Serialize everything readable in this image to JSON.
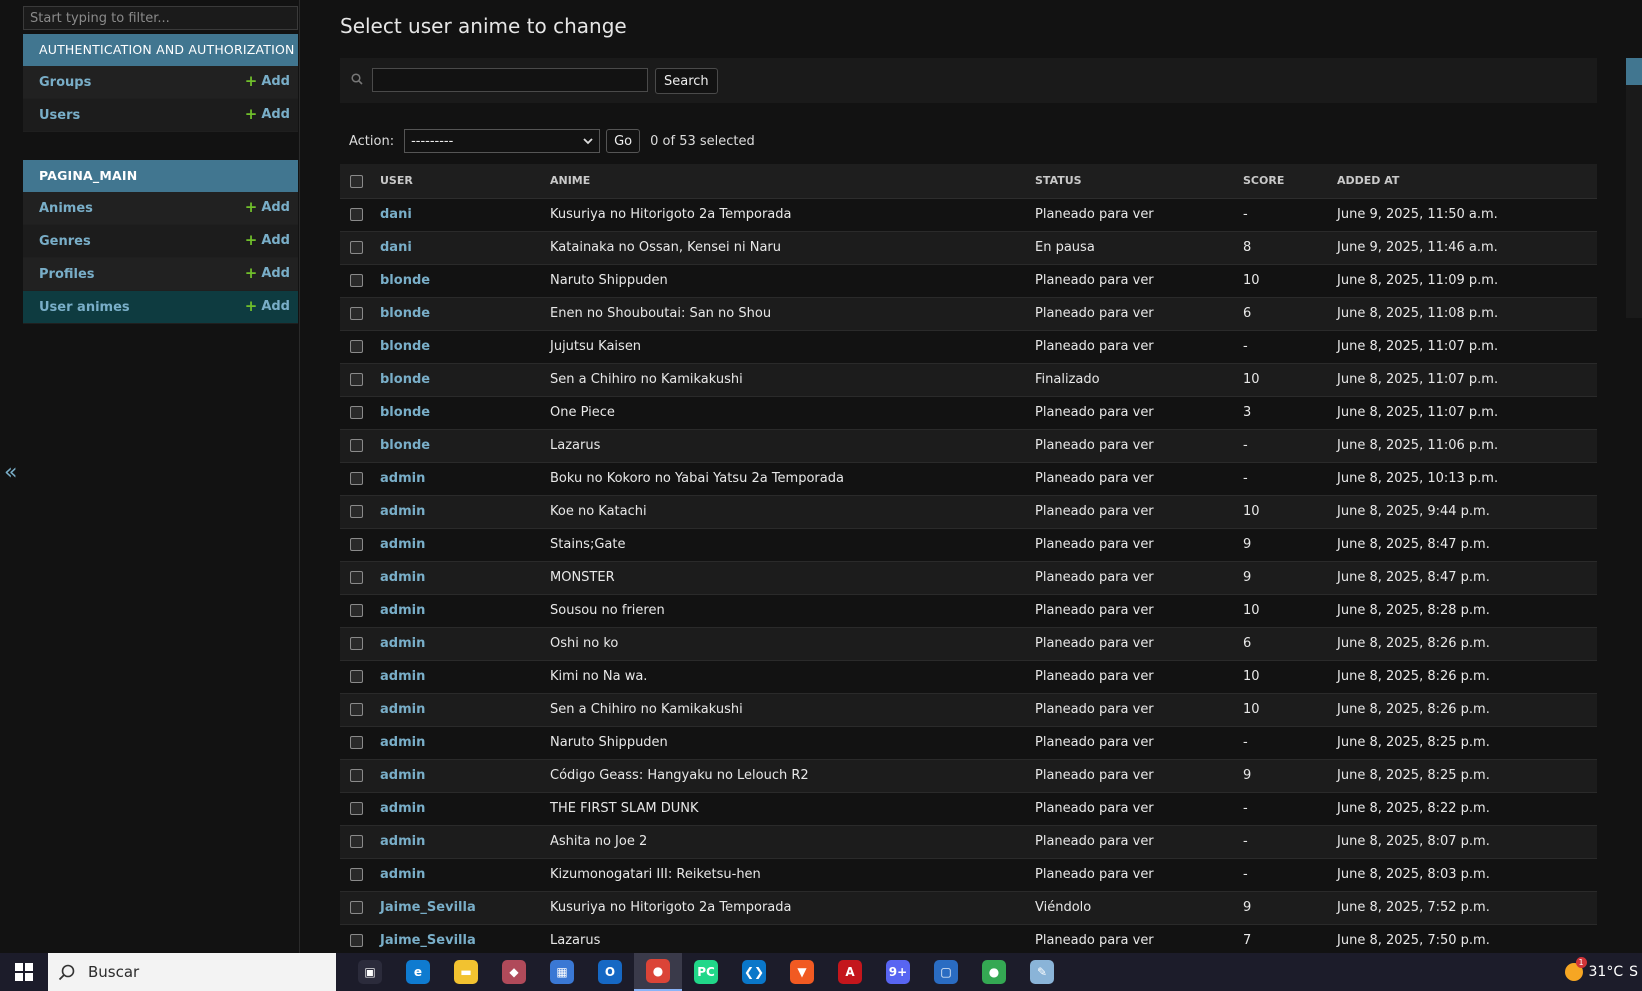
{
  "sidebar": {
    "filter_placeholder": "Start typing to filter...",
    "collapse_glyph": "«",
    "modules": [
      {
        "caption": "AUTHENTICATION AND AUTHORIZATION",
        "models": [
          {
            "label": "Groups",
            "add_label": "Add"
          },
          {
            "label": "Users",
            "add_label": "Add"
          }
        ]
      },
      {
        "caption": "PAGINA_MAIN",
        "models": [
          {
            "label": "Animes",
            "add_label": "Add"
          },
          {
            "label": "Genres",
            "add_label": "Add"
          },
          {
            "label": "Profiles",
            "add_label": "Add"
          },
          {
            "label": "User animes",
            "add_label": "Add",
            "current": true
          }
        ]
      }
    ]
  },
  "content": {
    "title": "Select user anime to change",
    "search_button": "Search",
    "action_label": "Action:",
    "action_selected": "---------",
    "go_button": "Go",
    "counter": "0 of 53 selected",
    "columns": [
      "User",
      "Anime",
      "Status",
      "Score",
      "Added at"
    ],
    "rows": [
      {
        "user": "dani",
        "anime": "Kusuriya no Hitorigoto 2a Temporada",
        "status": "Planeado para ver",
        "score": "-",
        "added": "June 9, 2025, 11:50 a.m."
      },
      {
        "user": "dani",
        "anime": "Katainaka no Ossan, Kensei ni Naru",
        "status": "En pausa",
        "score": "8",
        "added": "June 9, 2025, 11:46 a.m."
      },
      {
        "user": "blonde",
        "anime": "Naruto Shippuden",
        "status": "Planeado para ver",
        "score": "10",
        "added": "June 8, 2025, 11:09 p.m."
      },
      {
        "user": "blonde",
        "anime": "Enen no Shouboutai: San no Shou",
        "status": "Planeado para ver",
        "score": "6",
        "added": "June 8, 2025, 11:08 p.m."
      },
      {
        "user": "blonde",
        "anime": "Jujutsu Kaisen",
        "status": "Planeado para ver",
        "score": "-",
        "added": "June 8, 2025, 11:07 p.m."
      },
      {
        "user": "blonde",
        "anime": "Sen a Chihiro no Kamikakushi",
        "status": "Finalizado",
        "score": "10",
        "added": "June 8, 2025, 11:07 p.m."
      },
      {
        "user": "blonde",
        "anime": "One Piece",
        "status": "Planeado para ver",
        "score": "3",
        "added": "June 8, 2025, 11:07 p.m."
      },
      {
        "user": "blonde",
        "anime": "Lazarus",
        "status": "Planeado para ver",
        "score": "-",
        "added": "June 8, 2025, 11:06 p.m."
      },
      {
        "user": "admin",
        "anime": "Boku no Kokoro no Yabai Yatsu 2a Temporada",
        "status": "Planeado para ver",
        "score": "-",
        "added": "June 8, 2025, 10:13 p.m."
      },
      {
        "user": "admin",
        "anime": "Koe no Katachi",
        "status": "Planeado para ver",
        "score": "10",
        "added": "June 8, 2025, 9:44 p.m."
      },
      {
        "user": "admin",
        "anime": "Stains;Gate",
        "status": "Planeado para ver",
        "score": "9",
        "added": "June 8, 2025, 8:47 p.m."
      },
      {
        "user": "admin",
        "anime": "MONSTER",
        "status": "Planeado para ver",
        "score": "9",
        "added": "June 8, 2025, 8:47 p.m."
      },
      {
        "user": "admin",
        "anime": "Sousou no frieren",
        "status": "Planeado para ver",
        "score": "10",
        "added": "June 8, 2025, 8:28 p.m."
      },
      {
        "user": "admin",
        "anime": "Oshi no ko",
        "status": "Planeado para ver",
        "score": "6",
        "added": "June 8, 2025, 8:26 p.m."
      },
      {
        "user": "admin",
        "anime": "Kimi no Na wa.",
        "status": "Planeado para ver",
        "score": "10",
        "added": "June 8, 2025, 8:26 p.m."
      },
      {
        "user": "admin",
        "anime": "Sen a Chihiro no Kamikakushi",
        "status": "Planeado para ver",
        "score": "10",
        "added": "June 8, 2025, 8:26 p.m."
      },
      {
        "user": "admin",
        "anime": "Naruto Shippuden",
        "status": "Planeado para ver",
        "score": "-",
        "added": "June 8, 2025, 8:25 p.m."
      },
      {
        "user": "admin",
        "anime": "Código Geass: Hangyaku no Lelouch R2",
        "status": "Planeado para ver",
        "score": "9",
        "added": "June 8, 2025, 8:25 p.m."
      },
      {
        "user": "admin",
        "anime": "THE FIRST SLAM DUNK",
        "status": "Planeado para ver",
        "score": "-",
        "added": "June 8, 2025, 8:22 p.m."
      },
      {
        "user": "admin",
        "anime": "Ashita no Joe 2",
        "status": "Planeado para ver",
        "score": "-",
        "added": "June 8, 2025, 8:07 p.m."
      },
      {
        "user": "admin",
        "anime": "Kizumonogatari III: Reiketsu-hen",
        "status": "Planeado para ver",
        "score": "-",
        "added": "June 8, 2025, 8:03 p.m."
      },
      {
        "user": "Jaime_Sevilla",
        "anime": "Kusuriya no Hitorigoto 2a Temporada",
        "status": "Viéndolo",
        "score": "9",
        "added": "June 8, 2025, 7:52 p.m."
      },
      {
        "user": "Jaime_Sevilla",
        "anime": "Lazarus",
        "status": "Planeado para ver",
        "score": "7",
        "added": "June 8, 2025, 7:50 p.m."
      }
    ]
  },
  "taskbar": {
    "search_label": "Buscar",
    "apps": [
      {
        "name": "task-view-icon",
        "color": "#2b2b3b",
        "glyph": "▣"
      },
      {
        "name": "edge-icon",
        "color": "#0f7bd0",
        "glyph": "e"
      },
      {
        "name": "file-explorer-icon",
        "color": "#f2c230",
        "glyph": "▬"
      },
      {
        "name": "app-icon",
        "color": "#b04a5a",
        "glyph": "◆"
      },
      {
        "name": "store-icon",
        "color": "#3a78d4",
        "glyph": "▦"
      },
      {
        "name": "outlook-icon",
        "color": "#1668c4",
        "glyph": "O"
      },
      {
        "name": "chrome-icon",
        "color": "#db4437",
        "glyph": "●",
        "active": true
      },
      {
        "name": "pycharm-icon",
        "color": "#21d789",
        "glyph": "PC"
      },
      {
        "name": "vscode-icon",
        "color": "#0a77c9",
        "glyph": "❮❯"
      },
      {
        "name": "brave-icon",
        "color": "#f15a22",
        "glyph": "▼"
      },
      {
        "name": "acrobat-icon",
        "color": "#c4161c",
        "glyph": "A"
      },
      {
        "name": "discord-icon",
        "color": "#5865f2",
        "glyph": "9+"
      },
      {
        "name": "virtualbox-icon",
        "color": "#2a6cc2",
        "glyph": "▢"
      },
      {
        "name": "chrome-profile-icon",
        "color": "#34a853",
        "glyph": "●"
      },
      {
        "name": "notepad-icon",
        "color": "#8ab4d8",
        "glyph": "✎"
      }
    ],
    "weather": "31°C",
    "weather_extra": "S"
  }
}
